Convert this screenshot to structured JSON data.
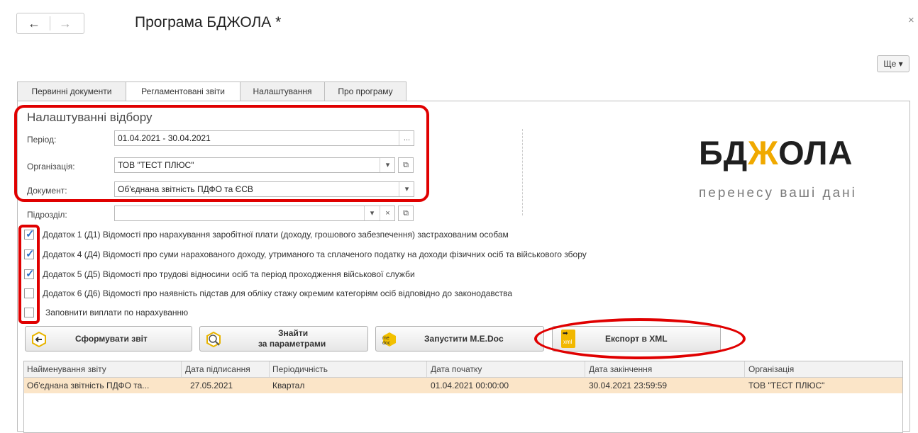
{
  "header": {
    "title": "Програма БДЖОЛА *",
    "back_icon": "←",
    "forward_icon": "→",
    "close_icon": "×",
    "more_label": "Ще ▾"
  },
  "tabs": [
    {
      "label": "Первинні документи"
    },
    {
      "label": "Регламентовані звіти",
      "active": true
    },
    {
      "label": "Налаштування"
    },
    {
      "label": "Про програму"
    }
  ],
  "filters": {
    "section_title": "Налаштуванні відбору",
    "period_label": "Період:",
    "period_value": "01.04.2021 - 30.04.2021",
    "period_button": "...",
    "org_label": "Організація:",
    "org_value": "ТОВ \"ТЕСТ ПЛЮС\"",
    "doc_label": "Документ:",
    "doc_value": "Об'єднана звітність ПДФО та ЄСВ",
    "dept_label": "Підрозділ:",
    "dept_value": ""
  },
  "logo": {
    "left": "БД",
    "mid": "Ж",
    "right": "ОЛА",
    "slogan": "перенесу ваші дані",
    "accent_color": "#f0a900"
  },
  "checkboxes": [
    {
      "label": "Додаток 1 (Д1) Відомості про нарахування заробітної плати (доходу, грошового забезпечення) застрахованим особам",
      "checked": true
    },
    {
      "label": "Додаток 4 (Д4) Відомості про суми нарахованого доходу, утриманого та сплаченого податку на доходи фізичних осіб та військового збору",
      "checked": true
    },
    {
      "label": "Додаток 5 (Д5) Відомості про трудові відносини осіб та період проходження військової служби",
      "checked": true
    },
    {
      "label": "Додаток 6 (Д6) Відомості про наявність підстав для обліку стажу окремим категоріям осіб відповідно до законодавства",
      "checked": false
    },
    {
      "label": "Заповнити виплати по нарахуванню",
      "checked": false
    }
  ],
  "actions": {
    "generate": "Сформувати звіт",
    "find_line1": "Знайти",
    "find_line2": "за параметрами",
    "medoc": "Запустити M.E.Doc",
    "medoc_icon": "me doc",
    "export": "Експорт в XML",
    "export_icon": "xml"
  },
  "table": {
    "columns": [
      "Найменування звіту",
      "Дата підписання",
      "Періодичність",
      "Дата початку",
      "Дата закінчення",
      "Організація"
    ],
    "rows": [
      [
        "Об'єднана звітність ПДФО та...",
        "27.05.2021",
        "Квартал",
        "01.04.2021 00:00:00",
        "30.04.2021 23:59:59",
        "ТОВ \"ТЕСТ ПЛЮС\""
      ]
    ]
  }
}
